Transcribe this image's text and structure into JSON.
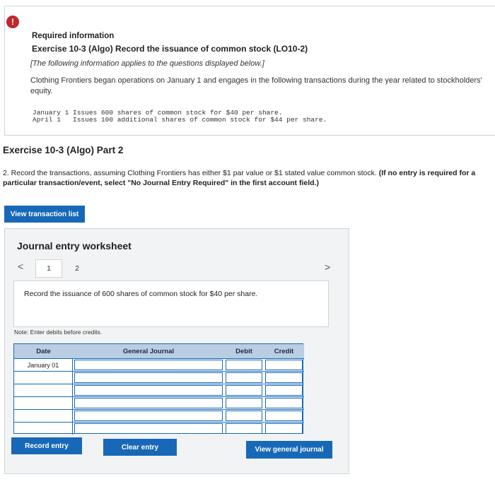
{
  "info": {
    "alert_glyph": "!",
    "required_label": "Required information",
    "exercise_title": "Exercise 10-3 (Algo) Record the issuance of common stock (LO10-2)",
    "applies_note": "[The following information applies to the questions displayed below.]",
    "description": "Clothing Frontiers began operations on January 1 and engages in the following transactions during the year related to stockholders' equity.",
    "transactions": [
      "January 1 Issues 600 shares of common stock for $40 per share.",
      "April 1   Issues 100 additional shares of common stock for $44 per share."
    ]
  },
  "part": {
    "title": "Exercise 10-3 (Algo) Part 2",
    "instruction_regular": "2. Record the transactions, assuming Clothing Frontiers has either $1 par value or $1 stated value common stock.",
    "instruction_bold": "(If no entry is required for a particular transaction/event, select \"No Journal Entry Required\" in the first account field.)"
  },
  "buttons": {
    "view_transaction_list": "View transaction list",
    "record_entry": "Record entry",
    "clear_entry": "Clear entry",
    "view_general_journal": "View general journal"
  },
  "worksheet": {
    "title": "Journal entry worksheet",
    "prev_glyph": "<",
    "next_glyph": ">",
    "pages": [
      "1",
      "2"
    ],
    "prompt": "Record the issuance of 600 shares of common stock for $40 per share.",
    "note": "Note: Enter debits before credits.",
    "table": {
      "headers": {
        "date": "Date",
        "general_journal": "General Journal",
        "debit": "Debit",
        "credit": "Credit"
      },
      "rows": [
        {
          "date": "January 01",
          "account": "",
          "debit": "",
          "credit": ""
        },
        {
          "date": "",
          "account": "",
          "debit": "",
          "credit": ""
        },
        {
          "date": "",
          "account": "",
          "debit": "",
          "credit": ""
        },
        {
          "date": "",
          "account": "",
          "debit": "",
          "credit": ""
        },
        {
          "date": "",
          "account": "",
          "debit": "",
          "credit": ""
        },
        {
          "date": "",
          "account": "",
          "debit": "",
          "credit": ""
        }
      ]
    }
  },
  "colors": {
    "accent_blue": "#1769b8",
    "header_blue": "#b9cde3",
    "alert_red": "#c0262d"
  }
}
